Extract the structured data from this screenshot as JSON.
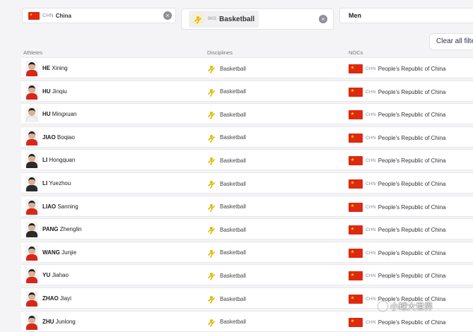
{
  "filters": {
    "noc": {
      "code": "CHN",
      "label": "China",
      "icon": "flag-china-icon"
    },
    "discipline": {
      "code": "BKB",
      "label": "Basketball",
      "icon": "basketball-icon"
    },
    "gender": {
      "label": "Men"
    },
    "clear_all_label": "Clear all filters"
  },
  "columns": {
    "athletes": "Athletes",
    "disciplines": "Disciplines",
    "nocs": "NOCs"
  },
  "rows": [
    {
      "family": "HE",
      "given": "Xining",
      "discipline": "Basketball",
      "noc_code": "CHN",
      "noc": "People's Republic of China"
    },
    {
      "family": "HU",
      "given": "Jinqiu",
      "discipline": "Basketball",
      "noc_code": "CHN",
      "noc": "People's Republic of China"
    },
    {
      "family": "HU",
      "given": "Mingxuan",
      "discipline": "Basketball",
      "noc_code": "CHN",
      "noc": "People's Republic of China"
    },
    {
      "family": "JIAO",
      "given": "Boqiao",
      "discipline": "Basketball",
      "noc_code": "CHN",
      "noc": "People's Republic of China"
    },
    {
      "family": "LI",
      "given": "Hongquan",
      "discipline": "Basketball",
      "noc_code": "CHN",
      "noc": "People's Republic of China"
    },
    {
      "family": "LI",
      "given": "Yuezhou",
      "discipline": "Basketball",
      "noc_code": "CHN",
      "noc": "People's Republic of China"
    },
    {
      "family": "LIAO",
      "given": "Sanning",
      "discipline": "Basketball",
      "noc_code": "CHN",
      "noc": "People's Republic of China"
    },
    {
      "family": "PANG",
      "given": "Zhenglin",
      "discipline": "Basketball",
      "noc_code": "CHN",
      "noc": "People's Republic of China"
    },
    {
      "family": "WANG",
      "given": "Junjie",
      "discipline": "Basketball",
      "noc_code": "CHN",
      "noc": "People's Republic of China"
    },
    {
      "family": "YU",
      "given": "Jiahao",
      "discipline": "Basketball",
      "noc_code": "CHN",
      "noc": "People's Republic of China"
    },
    {
      "family": "ZHAO",
      "given": "Jiayi",
      "discipline": "Basketball",
      "noc_code": "CHN",
      "noc": "People's Republic of China"
    },
    {
      "family": "ZHU",
      "given": "Junlong",
      "discipline": "Basketball",
      "noc_code": "CHN",
      "noc": "People's Republic of China"
    }
  ],
  "watermark": "小球大世界",
  "colors": {
    "flag_red": "#de2910",
    "flag_yellow": "#ffde00",
    "basketball_icon": "#e3b800"
  }
}
